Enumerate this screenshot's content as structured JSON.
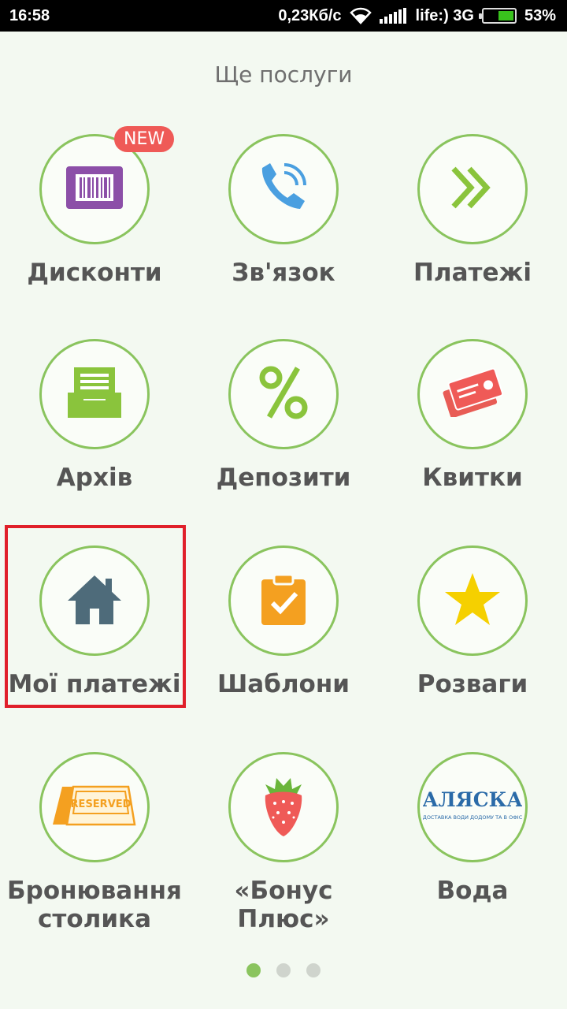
{
  "status_bar": {
    "time": "16:58",
    "speed": "0,23Кб/с",
    "carrier": "life:) 3G",
    "battery": "53%"
  },
  "page": {
    "title": "Ще послуги"
  },
  "tiles": [
    {
      "label": "Дисконти",
      "icon": "barcode-card-icon",
      "badge": "NEW"
    },
    {
      "label": "Зв'язок",
      "icon": "phone-call-icon"
    },
    {
      "label": "Платежі",
      "icon": "double-chevron-right-icon"
    },
    {
      "label": "Архів",
      "icon": "inbox-tray-icon"
    },
    {
      "label": "Депозити",
      "icon": "percent-icon"
    },
    {
      "label": "Квитки",
      "icon": "tickets-icon"
    },
    {
      "label": "Мої платежі",
      "icon": "home-icon"
    },
    {
      "label": "Шаблони",
      "icon": "clipboard-check-icon"
    },
    {
      "label": "Розваги",
      "icon": "star-icon"
    },
    {
      "label": "Бронювання столика",
      "icon": "reserved-sign-icon"
    },
    {
      "label": "«Бонус Плюс»",
      "icon": "strawberry-icon"
    },
    {
      "label": "Вода",
      "icon": "alaska-logo-icon"
    }
  ],
  "logos": {
    "alaska_name": "АЛЯСКА",
    "alaska_tagline": "ДОСТАВКА ВОДИ ДОДОМУ ТА В ОФІС",
    "reserved_text": "RESERVED"
  },
  "colors": {
    "accent": "#8ac45e",
    "highlight": "#e0202a",
    "badge": "#ef5a57"
  },
  "pager": {
    "pages": 3,
    "active": 1
  }
}
